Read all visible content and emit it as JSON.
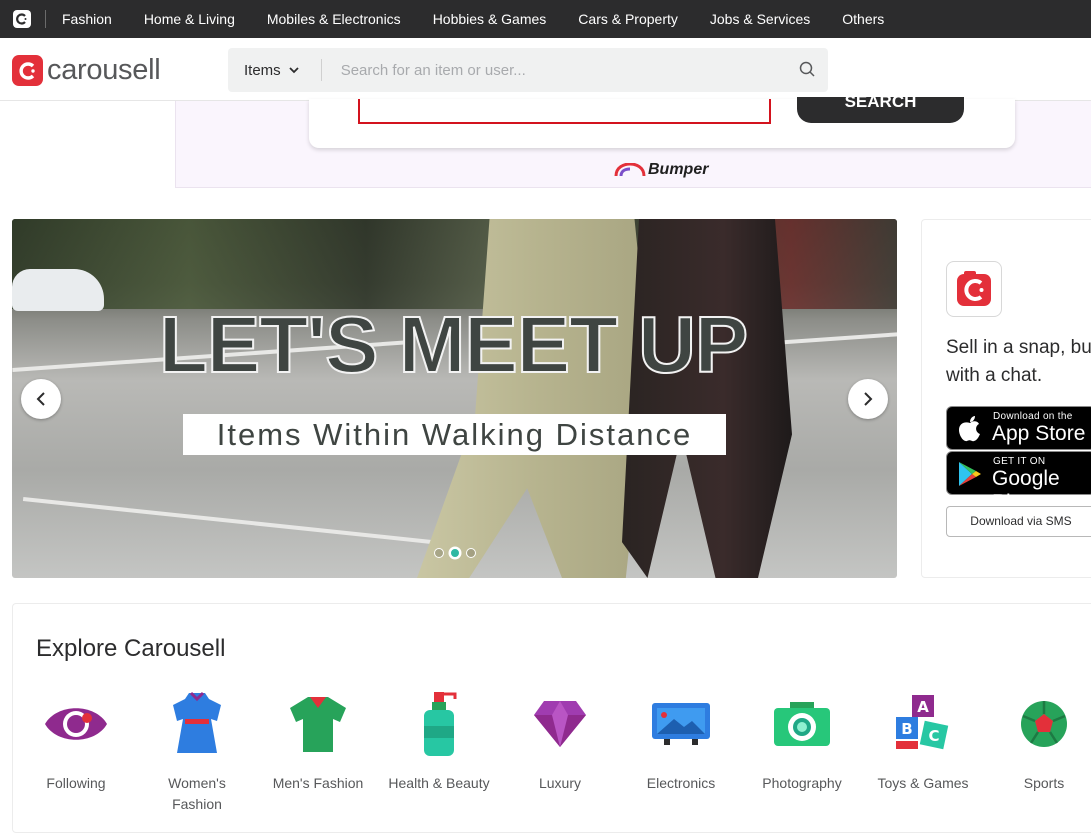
{
  "topbar": {
    "categories": [
      "Fashion",
      "Home & Living",
      "Mobiles & Electronics",
      "Hobbies & Games",
      "Cars & Property",
      "Jobs & Services",
      "Others"
    ]
  },
  "header": {
    "logo_text": "carousell",
    "search": {
      "type_label": "Items",
      "placeholder": "Search for an item or user..."
    }
  },
  "promo": {
    "button_label": "SEARCH",
    "brand": "Bumper"
  },
  "banner": {
    "headline": "LET'S MEET UP",
    "subline": "Items Within Walking Distance",
    "slide_count": 3,
    "active_slide": 2
  },
  "app_card": {
    "tagline": "Sell in a snap, buy with a chat.",
    "app_store_small": "Download on the",
    "app_store_big": "App Store",
    "google_small": "GET IT ON",
    "google_big": "Google Play",
    "sms_label": "Download via SMS"
  },
  "explore": {
    "title": "Explore Carousell",
    "items": [
      {
        "label": "Following",
        "icon": "eye-icon"
      },
      {
        "label": "Women's Fashion",
        "icon": "dress-icon"
      },
      {
        "label": "Men's Fashion",
        "icon": "shirt-icon"
      },
      {
        "label": "Health & Beauty",
        "icon": "pump-bottle-icon"
      },
      {
        "label": "Luxury",
        "icon": "diamond-icon"
      },
      {
        "label": "Electronics",
        "icon": "monitor-icon"
      },
      {
        "label": "Photography",
        "icon": "camera-icon"
      },
      {
        "label": "Toys & Games",
        "icon": "blocks-icon"
      },
      {
        "label": "Sports",
        "icon": "soccer-ball-icon"
      }
    ]
  },
  "colors": {
    "brand_red": "#e3303a",
    "topbar_bg": "#2c2c2d",
    "accent_teal": "#2fb8a3"
  }
}
